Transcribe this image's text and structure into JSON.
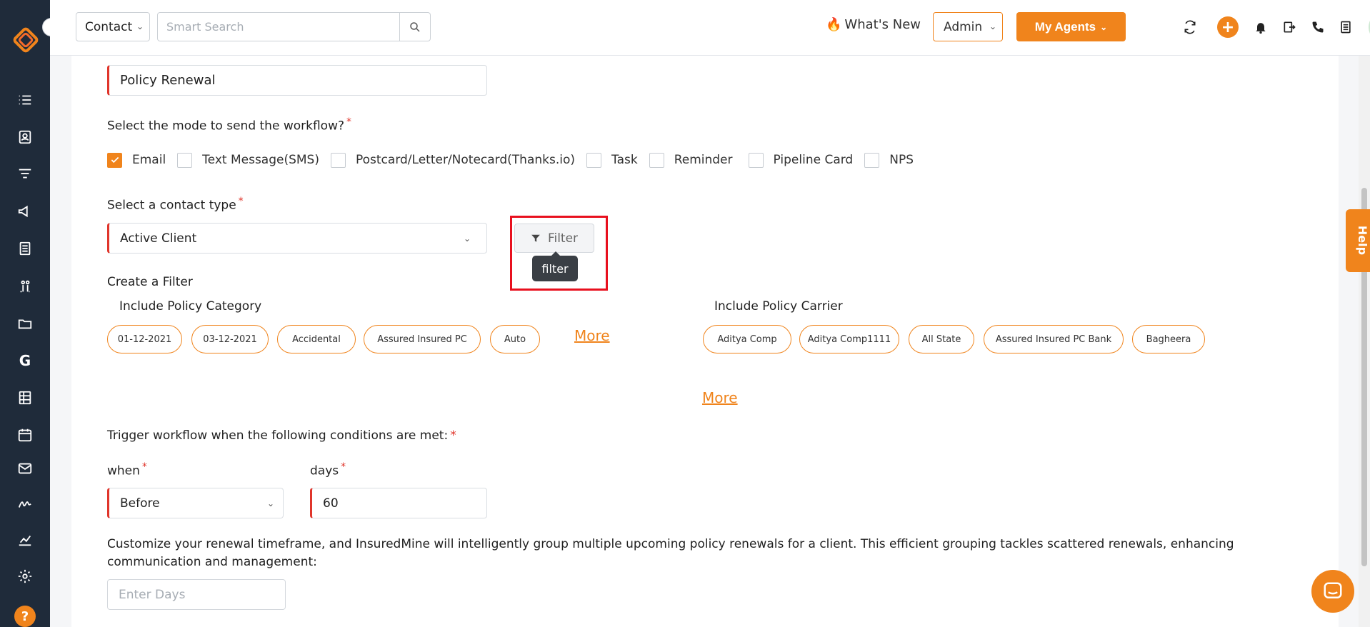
{
  "header": {
    "module_select": "Contact",
    "search_placeholder": "Smart Search",
    "whats_new": "What's New",
    "whats_new_icon": "🔥",
    "role_select": "Admin",
    "agents_button": "My Agents",
    "add_icon": "+"
  },
  "form": {
    "workflow_name": "Policy Renewal",
    "mode_label": "Select the mode to send the workflow?",
    "modes": [
      {
        "label": "Email",
        "checked": true
      },
      {
        "label": "Text Message(SMS)",
        "checked": false
      },
      {
        "label": "Postcard/Letter/Notecard(Thanks.io)",
        "checked": false
      },
      {
        "label": "Task",
        "checked": false
      },
      {
        "label": "Reminder",
        "checked": false
      },
      {
        "label": "Pipeline Card",
        "checked": false
      },
      {
        "label": "NPS",
        "checked": false
      }
    ],
    "contact_type_label": "Select a contact type",
    "contact_type_value": "Active Client",
    "filter_button": "Filter",
    "filter_tooltip": "filter",
    "create_filter_label": "Create a Filter",
    "policy_category_label": "Include Policy Category",
    "policy_categories": [
      "01-12-2021",
      "03-12-2021",
      "Accidental",
      "Assured Insured PC",
      "Auto"
    ],
    "more_category": "More",
    "policy_carrier_label": "Include Policy Carrier",
    "policy_carriers": [
      "Aditya Comp",
      "Aditya Comp1111",
      "All State",
      "Assured Insured PC Bank",
      "Bagheera"
    ],
    "more_carrier": "More",
    "trigger_label": "Trigger workflow when the following conditions are met:",
    "when_label": "when",
    "when_value": "Before",
    "days_label": "days",
    "days_value": "60",
    "customize_text": "Customize your renewal timeframe, and InsuredMine will intelligently group multiple upcoming policy renewals for a client. This efficient grouping tackles scattered renewals, enhancing communication and management:",
    "enter_days_placeholder": "Enter Days",
    "required_mark": "*"
  },
  "help_tab": "Help",
  "colors": {
    "accent": "#f0841c",
    "sidebar": "#1f2b3a",
    "required": "#e0352b",
    "highlight": "#e8101e"
  }
}
